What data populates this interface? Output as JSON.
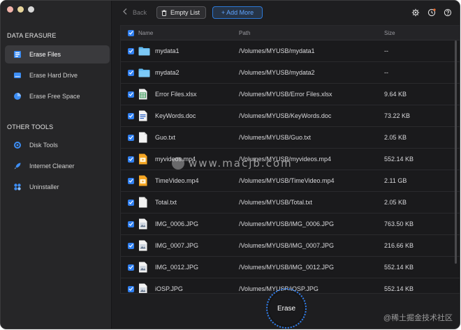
{
  "sidebar": {
    "section_data": "DATA ERASURE",
    "section_tools": "OTHER TOOLS",
    "items": [
      {
        "label": "Erase Files",
        "icon": "erase-files-icon",
        "active": true
      },
      {
        "label": "Erase Hard Drive",
        "icon": "hard-drive-icon",
        "active": false
      },
      {
        "label": "Erase Free Space",
        "icon": "pie-chart-icon",
        "active": false
      },
      {
        "label": "Disk Tools",
        "icon": "disk-tools-icon",
        "active": false
      },
      {
        "label": "Internet Cleaner",
        "icon": "rocket-icon",
        "active": false
      },
      {
        "label": "Uninstaller",
        "icon": "apps-grid-icon",
        "active": false
      }
    ]
  },
  "toolbar": {
    "back_label": "Back",
    "empty_list_label": "Empty List",
    "add_more_label": "+ Add More",
    "icons": [
      "gear-icon",
      "history-icon",
      "help-icon"
    ]
  },
  "table": {
    "headers": {
      "name": "Name",
      "path": "Path",
      "size": "Size"
    },
    "rows": [
      {
        "name": "mydata1",
        "path": "/Volumes/MYUSB/mydata1",
        "size": "--",
        "icon": "folder-icon"
      },
      {
        "name": "mydata2",
        "path": "/Volumes/MYUSB/mydata2",
        "size": "--",
        "icon": "folder-icon"
      },
      {
        "name": "Error Files.xlsx",
        "path": "/Volumes/MYUSB/Error Files.xlsx",
        "size": "9.64 KB",
        "icon": "excel-file-icon"
      },
      {
        "name": "KeyWords.doc",
        "path": "/Volumes/MYUSB/KeyWords.doc",
        "size": "73.22 KB",
        "icon": "word-file-icon"
      },
      {
        "name": "Guo.txt",
        "path": "/Volumes/MYUSB/Guo.txt",
        "size": "2.05 KB",
        "icon": "text-file-icon"
      },
      {
        "name": "myvideos.mp4",
        "path": "/Volumes/MYUSB/myvideos.mp4",
        "size": "552.14 KB",
        "icon": "video-file-icon"
      },
      {
        "name": "TimeVideo.mp4",
        "path": "/Volumes/MYUSB/TimeVideo.mp4",
        "size": "2.11 GB",
        "icon": "video-file-icon"
      },
      {
        "name": "Total.txt",
        "path": "/Volumes/MYUSB/Total.txt",
        "size": "2.05 KB",
        "icon": "text-file-icon"
      },
      {
        "name": "IMG_0006.JPG",
        "path": "/Volumes/MYUSB/IMG_0006.JPG",
        "size": "763.50 KB",
        "icon": "image-file-icon"
      },
      {
        "name": "IMG_0007.JPG",
        "path": "/Volumes/MYUSB/IMG_0007.JPG",
        "size": "216.66 KB",
        "icon": "image-file-icon"
      },
      {
        "name": "IMG_0012.JPG",
        "path": "/Volumes/MYUSB/IMG_0012.JPG",
        "size": "552.14 KB",
        "icon": "image-file-icon"
      },
      {
        "name": "iOSP.JPG",
        "path": "/Volumes/MYUSB/iOSP.JPG",
        "size": "552.14 KB",
        "icon": "image-file-icon"
      }
    ]
  },
  "erase_label": "Erase",
  "watermark": "www.macjb.com",
  "credit": "@稀土掘金技术社区",
  "colors": {
    "accent": "#2f7ff0",
    "folder": "#5fb8f0",
    "excel": "#e8e8e8",
    "video": "#f0a020"
  }
}
